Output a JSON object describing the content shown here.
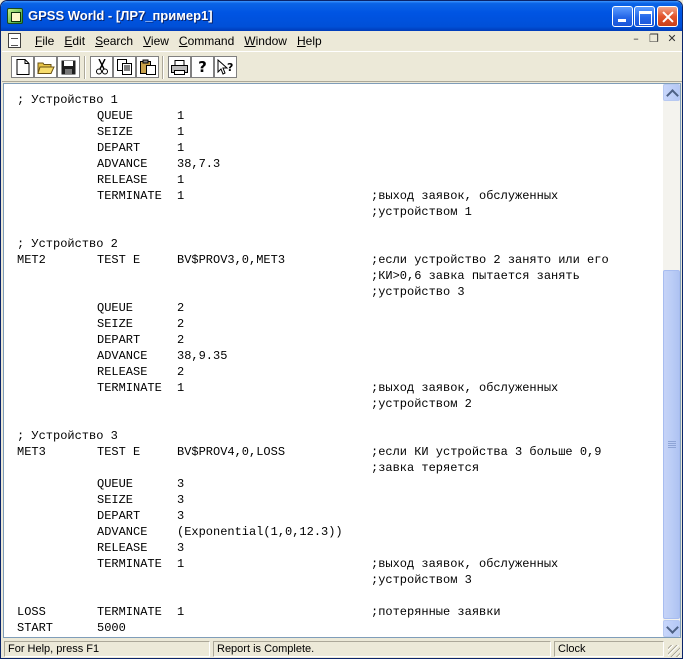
{
  "window": {
    "title": "GPSS World - [ЛР7_пример1]"
  },
  "menu": [
    {
      "label": "File",
      "key": "F",
      "rest": "ile"
    },
    {
      "label": "Edit",
      "key": "E",
      "rest": "dit"
    },
    {
      "label": "Search",
      "key": "S",
      "rest": "earch"
    },
    {
      "label": "View",
      "key": "V",
      "rest": "iew"
    },
    {
      "label": "Command",
      "key": "C",
      "rest": "ommand"
    },
    {
      "label": "Window",
      "key": "W",
      "rest": "indow"
    },
    {
      "label": "Help",
      "key": "H",
      "rest": "elp"
    }
  ],
  "toolbar": {
    "icons": [
      "new-file-icon",
      "open-folder-icon",
      "save-icon",
      "cut-icon",
      "copy-icon",
      "paste-icon",
      "print-icon",
      "help-icon",
      "context-help-icon"
    ]
  },
  "editor": {
    "lines": [
      {
        "label": "; Устройство 1",
        "op": "",
        "arg": "",
        "cmt": ""
      },
      {
        "label": "",
        "op": "QUEUE",
        "arg": "1",
        "cmt": ""
      },
      {
        "label": "",
        "op": "SEIZE",
        "arg": "1",
        "cmt": ""
      },
      {
        "label": "",
        "op": "DEPART",
        "arg": "1",
        "cmt": ""
      },
      {
        "label": "",
        "op": "ADVANCE",
        "arg": "38,7.3",
        "cmt": ""
      },
      {
        "label": "",
        "op": "RELEASE",
        "arg": "1",
        "cmt": ""
      },
      {
        "label": "",
        "op": "TERMINATE",
        "arg": "1",
        "cmt": ";выход заявок, обслуженных"
      },
      {
        "label": "",
        "op": "",
        "arg": "",
        "cmt": ";устройством 1"
      },
      {
        "label": "",
        "op": "",
        "arg": "",
        "cmt": ""
      },
      {
        "label": "; Устройство 2",
        "op": "",
        "arg": "",
        "cmt": ""
      },
      {
        "label": "MET2",
        "op": "TEST E",
        "arg": "BV$PROV3,0,MET3",
        "cmt": ";если устройство 2 занято или его"
      },
      {
        "label": "",
        "op": "",
        "arg": "",
        "cmt": ";КИ>0,6 завка пытается занять"
      },
      {
        "label": "",
        "op": "",
        "arg": "",
        "cmt": ";устройство 3"
      },
      {
        "label": "",
        "op": "QUEUE",
        "arg": "2",
        "cmt": ""
      },
      {
        "label": "",
        "op": "SEIZE",
        "arg": "2",
        "cmt": ""
      },
      {
        "label": "",
        "op": "DEPART",
        "arg": "2",
        "cmt": ""
      },
      {
        "label": "",
        "op": "ADVANCE",
        "arg": "38,9.35",
        "cmt": ""
      },
      {
        "label": "",
        "op": "RELEASE",
        "arg": "2",
        "cmt": ""
      },
      {
        "label": "",
        "op": "TERMINATE",
        "arg": "1",
        "cmt": ";выход заявок, обслуженных"
      },
      {
        "label": "",
        "op": "",
        "arg": "",
        "cmt": ";устройством 2"
      },
      {
        "label": "",
        "op": "",
        "arg": "",
        "cmt": ""
      },
      {
        "label": "; Устройство 3",
        "op": "",
        "arg": "",
        "cmt": ""
      },
      {
        "label": "MET3",
        "op": "TEST E",
        "arg": "BV$PROV4,0,LOSS",
        "cmt": ";если КИ устройства 3 больше 0,9"
      },
      {
        "label": "",
        "op": "",
        "arg": "",
        "cmt": ";завка теряется"
      },
      {
        "label": "",
        "op": "QUEUE",
        "arg": "3",
        "cmt": ""
      },
      {
        "label": "",
        "op": "SEIZE",
        "arg": "3",
        "cmt": ""
      },
      {
        "label": "",
        "op": "DEPART",
        "arg": "3",
        "cmt": ""
      },
      {
        "label": "",
        "op": "ADVANCE",
        "arg": "(Exponential(1,0,12.3))",
        "cmt": ""
      },
      {
        "label": "",
        "op": "RELEASE",
        "arg": "3",
        "cmt": ""
      },
      {
        "label": "",
        "op": "TERMINATE",
        "arg": "1",
        "cmt": ";выход заявок, обслуженных"
      },
      {
        "label": "",
        "op": "",
        "arg": "",
        "cmt": ";устройством 3"
      },
      {
        "label": "",
        "op": "",
        "arg": "",
        "cmt": ""
      },
      {
        "label": "LOSS",
        "op": "TERMINATE",
        "arg": "1",
        "cmt": ";потерянные заявки"
      },
      {
        "label": "START",
        "op": "5000",
        "arg": "",
        "cmt": ""
      }
    ]
  },
  "status": {
    "help": "For Help, press F1",
    "report": "Report is Complete.",
    "clock": "Clock"
  }
}
